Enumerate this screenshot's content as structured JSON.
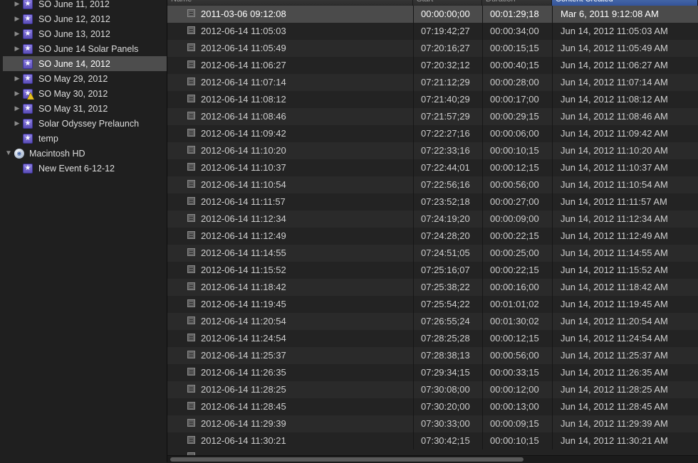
{
  "sidebar": {
    "events": [
      {
        "label": "SO June 11, 2012",
        "expandable": true,
        "icon": "event-star-icon"
      },
      {
        "label": "SO June 12, 2012",
        "expandable": true,
        "icon": "event-star-icon"
      },
      {
        "label": "SO June 13, 2012",
        "expandable": true,
        "icon": "event-star-icon"
      },
      {
        "label": "SO June 14 Solar Panels",
        "expandable": true,
        "icon": "event-star-icon"
      },
      {
        "label": "SO June 14, 2012",
        "expandable": false,
        "icon": "event-star-icon",
        "selected": true
      },
      {
        "label": "SO May 29, 2012",
        "expandable": true,
        "icon": "event-star-icon"
      },
      {
        "label": "SO May 30, 2012",
        "expandable": true,
        "icon": "event-star-icon",
        "warning": true
      },
      {
        "label": "SO May 31, 2012",
        "expandable": true,
        "icon": "event-star-icon"
      },
      {
        "label": "Solar Odyssey Prelaunch",
        "expandable": true,
        "icon": "event-star-icon"
      },
      {
        "label": "temp",
        "expandable": false,
        "icon": "event-star-icon"
      }
    ],
    "volume": {
      "label": "Macintosh HD",
      "icon": "hard-drive-icon",
      "expanded": true
    },
    "volume_events": [
      {
        "label": "New Event 6-12-12",
        "icon": "event-star-icon"
      }
    ]
  },
  "table": {
    "columns": {
      "name": "Name",
      "start": "Start",
      "duration": "Duration",
      "created": "Content Created"
    },
    "sorted_column": "created",
    "rows": [
      {
        "name": "2011-03-06 09:12:08",
        "start": "00:00:00;00",
        "duration": "00:01:29;18",
        "created": "Mar 6, 2011 9:12:08 AM"
      },
      {
        "name": "2012-06-14 11:05:03",
        "start": "07:19:42;27",
        "duration": "00:00:34;00",
        "created": "Jun 14, 2012 11:05:03 AM"
      },
      {
        "name": "2012-06-14 11:05:49",
        "start": "07:20:16;27",
        "duration": "00:00:15;15",
        "created": "Jun 14, 2012 11:05:49 AM"
      },
      {
        "name": "2012-06-14 11:06:27",
        "start": "07:20:32;12",
        "duration": "00:00:40;15",
        "created": "Jun 14, 2012 11:06:27 AM"
      },
      {
        "name": "2012-06-14 11:07:14",
        "start": "07:21:12;29",
        "duration": "00:00:28;00",
        "created": "Jun 14, 2012 11:07:14 AM"
      },
      {
        "name": "2012-06-14 11:08:12",
        "start": "07:21:40;29",
        "duration": "00:00:17;00",
        "created": "Jun 14, 2012 11:08:12 AM"
      },
      {
        "name": "2012-06-14 11:08:46",
        "start": "07:21:57;29",
        "duration": "00:00:29;15",
        "created": "Jun 14, 2012 11:08:46 AM"
      },
      {
        "name": "2012-06-14 11:09:42",
        "start": "07:22:27;16",
        "duration": "00:00:06;00",
        "created": "Jun 14, 2012 11:09:42 AM"
      },
      {
        "name": "2012-06-14 11:10:20",
        "start": "07:22:33;16",
        "duration": "00:00:10;15",
        "created": "Jun 14, 2012 11:10:20 AM"
      },
      {
        "name": "2012-06-14 11:10:37",
        "start": "07:22:44;01",
        "duration": "00:00:12;15",
        "created": "Jun 14, 2012 11:10:37 AM"
      },
      {
        "name": "2012-06-14 11:10:54",
        "start": "07:22:56;16",
        "duration": "00:00:56;00",
        "created": "Jun 14, 2012 11:10:54 AM"
      },
      {
        "name": "2012-06-14 11:11:57",
        "start": "07:23:52;18",
        "duration": "00:00:27;00",
        "created": "Jun 14, 2012 11:11:57 AM"
      },
      {
        "name": "2012-06-14 11:12:34",
        "start": "07:24:19;20",
        "duration": "00:00:09;00",
        "created": "Jun 14, 2012 11:12:34 AM"
      },
      {
        "name": "2012-06-14 11:12:49",
        "start": "07:24:28;20",
        "duration": "00:00:22;15",
        "created": "Jun 14, 2012 11:12:49 AM"
      },
      {
        "name": "2012-06-14 11:14:55",
        "start": "07:24:51;05",
        "duration": "00:00:25;00",
        "created": "Jun 14, 2012 11:14:55 AM"
      },
      {
        "name": "2012-06-14 11:15:52",
        "start": "07:25:16;07",
        "duration": "00:00:22;15",
        "created": "Jun 14, 2012 11:15:52 AM"
      },
      {
        "name": "2012-06-14 11:18:42",
        "start": "07:25:38;22",
        "duration": "00:00:16;00",
        "created": "Jun 14, 2012 11:18:42 AM"
      },
      {
        "name": "2012-06-14 11:19:45",
        "start": "07:25:54;22",
        "duration": "00:01:01;02",
        "created": "Jun 14, 2012 11:19:45 AM"
      },
      {
        "name": "2012-06-14 11:20:54",
        "start": "07:26:55;24",
        "duration": "00:01:30;02",
        "created": "Jun 14, 2012 11:20:54 AM"
      },
      {
        "name": "2012-06-14 11:24:54",
        "start": "07:28:25;28",
        "duration": "00:00:12;15",
        "created": "Jun 14, 2012 11:24:54 AM"
      },
      {
        "name": "2012-06-14 11:25:37",
        "start": "07:28:38;13",
        "duration": "00:00:56;00",
        "created": "Jun 14, 2012 11:25:37 AM"
      },
      {
        "name": "2012-06-14 11:26:35",
        "start": "07:29:34;15",
        "duration": "00:00:33;15",
        "created": "Jun 14, 2012 11:26:35 AM"
      },
      {
        "name": "2012-06-14 11:28:25",
        "start": "07:30:08;00",
        "duration": "00:00:12;00",
        "created": "Jun 14, 2012 11:28:25 AM"
      },
      {
        "name": "2012-06-14 11:28:45",
        "start": "07:30:20;00",
        "duration": "00:00:13;00",
        "created": "Jun 14, 2012 11:28:45 AM"
      },
      {
        "name": "2012-06-14 11:29:39",
        "start": "07:30:33;00",
        "duration": "00:00:09;15",
        "created": "Jun 14, 2012 11:29:39 AM"
      },
      {
        "name": "2012-06-14 11:30:21",
        "start": "07:30:42;15",
        "duration": "00:00:10;15",
        "created": "Jun 14, 2012 11:30:21 AM"
      }
    ],
    "selected_row": 0
  },
  "colors": {
    "background": "#1e1e1e",
    "selection": "#4b4b4b",
    "sorted_header": "#3d5fa3",
    "event_icon": "#6f62cc"
  }
}
